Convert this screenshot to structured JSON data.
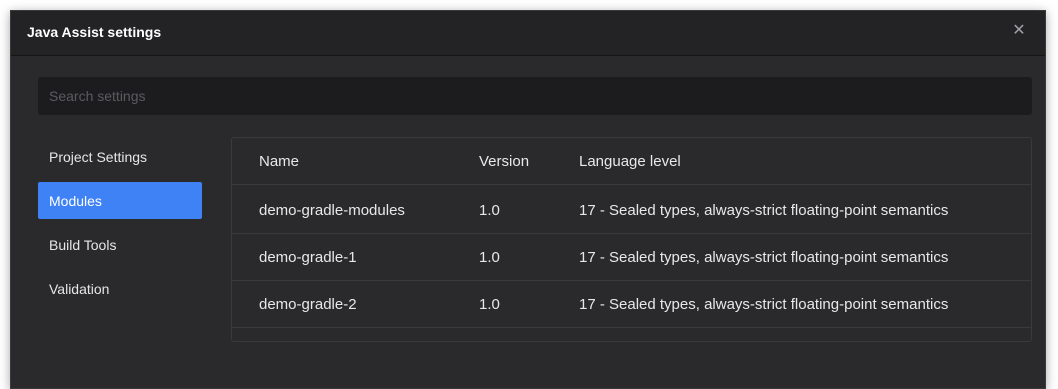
{
  "window": {
    "title": "Java Assist settings",
    "close_glyph": "✕"
  },
  "search": {
    "placeholder": "Search settings",
    "value": ""
  },
  "sidebar": {
    "items": [
      {
        "label": "Project Settings",
        "active": false
      },
      {
        "label": "Modules",
        "active": true
      },
      {
        "label": "Build Tools",
        "active": false
      },
      {
        "label": "Validation",
        "active": false
      }
    ]
  },
  "table": {
    "columns": [
      "Name",
      "Version",
      "Language level"
    ],
    "rows": [
      {
        "name": "demo-gradle-modules",
        "version": "1.0",
        "language_level": "17 - Sealed types, always-strict floating-point semantics"
      },
      {
        "name": "demo-gradle-1",
        "version": "1.0",
        "language_level": "17 - Sealed types, always-strict floating-point semantics"
      },
      {
        "name": "demo-gradle-2",
        "version": "1.0",
        "language_level": "17 - Sealed types, always-strict floating-point semantics"
      }
    ]
  },
  "colors": {
    "accent": "#3e82f5",
    "background": "#2a2a2c",
    "titlebar": "#232325"
  },
  "icons": {
    "close": "close-icon"
  }
}
